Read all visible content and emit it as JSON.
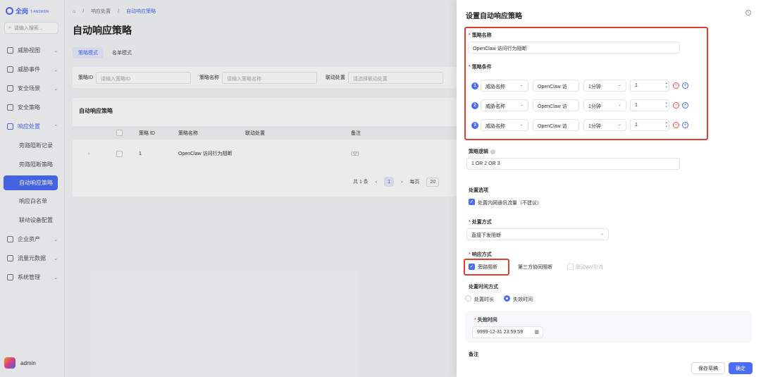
{
  "sidebar": {
    "logo_text": "全岗",
    "logo_sub": "T-ANSWER",
    "search_placeholder": "请输入搜索...",
    "items": [
      {
        "label": "威胁视图"
      },
      {
        "label": "威胁事件"
      },
      {
        "label": "安全场景"
      },
      {
        "label": "安全策略"
      },
      {
        "label": "响应处置"
      }
    ],
    "sub_items": [
      {
        "label": "旁路阻断记录"
      },
      {
        "label": "旁路阻断策略"
      },
      {
        "label": "自动响应策略"
      },
      {
        "label": "响应白名单"
      },
      {
        "label": "联动设备配置"
      }
    ],
    "bottom_items": [
      {
        "label": "企业资产"
      },
      {
        "label": "流量元数据"
      },
      {
        "label": "系统管理"
      }
    ],
    "user": "admin"
  },
  "main": {
    "breadcrumb": [
      "响应处置",
      "自动响应策略"
    ],
    "title": "自动响应策略",
    "tabs": [
      "策略模式",
      "名单模式"
    ],
    "filters": [
      {
        "label": "策略ID",
        "placeholder": "请输入策略ID"
      },
      {
        "label": "策略名称",
        "placeholder": "请输入策略名称"
      },
      {
        "label": "联动处置",
        "placeholder": "请选择联动处置"
      }
    ],
    "card_title": "自动响应策略",
    "columns": [
      "策略 ID",
      "策略名称",
      "联动处置",
      "备注"
    ],
    "rows": [
      {
        "id": "1",
        "name": "OpenClaw 访问行为阻断",
        "action": "",
        "remark": "(空)"
      }
    ],
    "pager": {
      "total_prefix": "共 1 条",
      "page": "1",
      "per_page_label": "每页",
      "per_page": "20"
    }
  },
  "drawer": {
    "title": "设置自动响应策略",
    "policy_name_label": "策略名称",
    "policy_name_value": "OpenClaw 访问行为阻断",
    "conditions_label": "策略条件",
    "conditions": [
      {
        "index": "1",
        "field": "威胁名称",
        "value": "OpenClaw 访",
        "window": "1分钟",
        "count": "1"
      },
      {
        "index": "2",
        "field": "威胁名称",
        "value": "OpenClaw 访",
        "window": "1分钟",
        "count": "1"
      },
      {
        "index": "3",
        "field": "威胁名称",
        "value": "OpenClaw 访",
        "window": "1分钟",
        "count": "1"
      }
    ],
    "logic_label": "策略逻辑",
    "logic_value": "1 OR 2 OR 3",
    "option_label": "处置选项",
    "option_value": "处置内网通讯流量（不建议）",
    "method_label": "处置方式",
    "method_value": "直接下发阻断",
    "response_label": "响应方式",
    "response_options": [
      "旁路阻断",
      "第三方协同阻断",
      "联动waf引流"
    ],
    "time_mode_label": "处置时间方式",
    "time_modes": [
      "处置时长",
      "失效时间"
    ],
    "expire_label": "失效时间",
    "expire_value": "9999-12-31 23:59:59",
    "remark_label": "备注",
    "save_draft": "保存草稿",
    "confirm": "确定"
  },
  "colors": {
    "accent": "#4a6cf7",
    "danger": "#f04b4b",
    "highlight": "#e33d2e"
  }
}
